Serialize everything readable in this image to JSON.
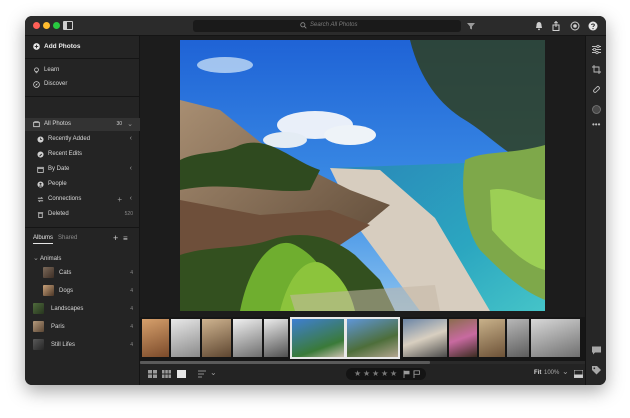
{
  "titlebar": {
    "search_placeholder": "Search All Photos"
  },
  "sidebar": {
    "add_photos": "Add Photos",
    "learn": "Learn",
    "discover": "Discover",
    "library": [
      {
        "label": "All Photos",
        "count": "30",
        "icon": "photos-icon"
      },
      {
        "label": "Recently Added",
        "icon": "clock-icon"
      },
      {
        "label": "Recent Edits",
        "icon": "edit-icon"
      },
      {
        "label": "By Date",
        "icon": "calendar-icon"
      },
      {
        "label": "People",
        "icon": "person-icon"
      },
      {
        "label": "Connections",
        "icon": "connections-icon"
      },
      {
        "label": "Deleted",
        "count": "520",
        "icon": "trash-icon"
      }
    ],
    "tabs": {
      "albums": "Albums",
      "shared": "Shared"
    },
    "albums": {
      "group": "Animals",
      "items": [
        {
          "label": "Cats",
          "count": "4"
        },
        {
          "label": "Dogs",
          "count": "4"
        },
        {
          "label": "Landscapes",
          "count": "4"
        },
        {
          "label": "Paris",
          "count": "4"
        },
        {
          "label": "Still Lifes",
          "count": "4"
        }
      ]
    }
  },
  "bottombar": {
    "fit_label": "Fit",
    "zoom_level": "100%"
  },
  "colors": {
    "window_bg": "#1e1e1e",
    "sidebar_bg": "#242424",
    "selection_bg": "#333333",
    "selection_border": "#e8e8e8"
  }
}
